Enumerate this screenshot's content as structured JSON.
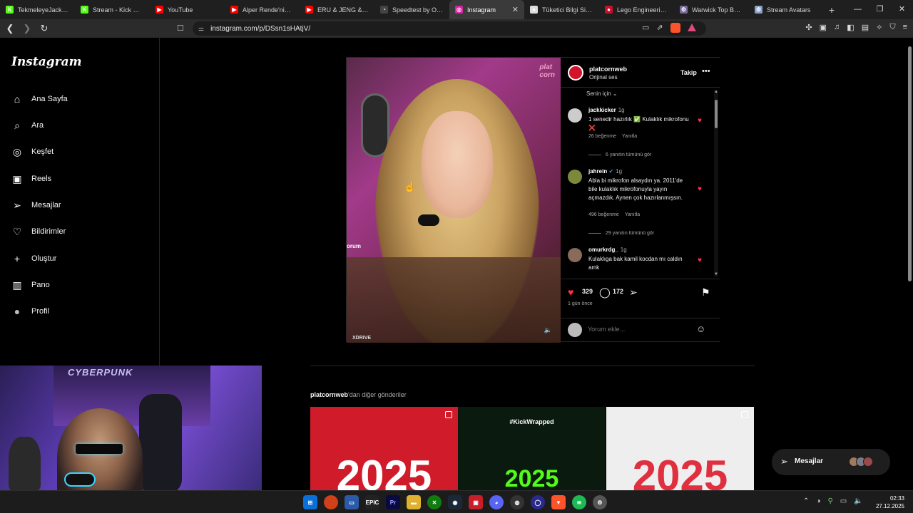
{
  "browser": {
    "tabs": [
      {
        "title": "TekmeleyeJack Strea",
        "fav_color": "#53fc18",
        "fav_text": "K"
      },
      {
        "title": "Stream - Kick Dashb",
        "fav_color": "#53fc18",
        "fav_text": "K"
      },
      {
        "title": "YouTube",
        "fav_color": "#ff0000",
        "fav_text": "▶"
      },
      {
        "title": "Alper Rende'nin Am",
        "fav_color": "#ff0000",
        "fav_text": "▶"
      },
      {
        "title": "ERU & JENG & KOK",
        "fav_color": "#ff0000",
        "fav_text": "▶"
      },
      {
        "title": "Speedtest by Ookla",
        "fav_color": "#444444",
        "fav_text": "◔"
      },
      {
        "title": "Instagram",
        "fav_color": "#d6249f",
        "fav_text": "◎",
        "active": true
      },
      {
        "title": "Tüketici Bilgi Sistem",
        "fav_color": "#dddddd",
        "fav_text": "●"
      },
      {
        "title": "Lego Engineering: B",
        "fav_color": "#c8102e",
        "fav_text": "●"
      },
      {
        "title": "Warwick Top Build U",
        "fav_color": "#7a6a9a",
        "fav_text": "⚙"
      },
      {
        "title": "Stream Avatars",
        "fav_color": "#8aa0c8",
        "fav_text": "⚙"
      }
    ],
    "url": "instagram.com/p/DSsn1sHAtjV/"
  },
  "sidebar": {
    "logo": "Instagram",
    "items": [
      {
        "label": "Ana Sayfa",
        "icon": "home-icon",
        "glyph": "⌂"
      },
      {
        "label": "Ara",
        "icon": "search-icon",
        "glyph": "⌕"
      },
      {
        "label": "Keşfet",
        "icon": "compass-icon",
        "glyph": "◎"
      },
      {
        "label": "Reels",
        "icon": "reels-icon",
        "glyph": "▣"
      },
      {
        "label": "Mesajlar",
        "icon": "send-icon",
        "glyph": "➢"
      },
      {
        "label": "Bildirimler",
        "icon": "heart-icon",
        "glyph": "♡"
      },
      {
        "label": "Oluştur",
        "icon": "plus-icon",
        "glyph": "+"
      },
      {
        "label": "Pano",
        "icon": "dashboard-icon",
        "glyph": "▥"
      },
      {
        "label": "Profil",
        "icon": "profile-avatar-icon",
        "glyph": "●"
      }
    ]
  },
  "post": {
    "username": "platcornweb",
    "audio": "Orijinal ses",
    "follow_label": "Takip",
    "media_overlay_text": "orum",
    "media_watermark": "XDRIVE",
    "sort_label": "Senin için",
    "comments": [
      {
        "user": "jackkicker",
        "age": "1g",
        "text": "1 senedir hazırlık ✅ Kulaklık mikrofonu ❌",
        "likes": "26 beğenme",
        "reply": "Yanıtla",
        "replies": "6 yanıtın tümünü gör",
        "verified": false,
        "avatar_color": "#cccccc"
      },
      {
        "user": "jahrein",
        "age": "1g",
        "text": "Abla bi mikrofon alsaydın ya. 2011'de bile kulaklık mikrofonuyla yayın açmazdık. Aynen çok hazırlanmışsın.",
        "likes": "496 beğenme",
        "reply": "Yanıtla",
        "replies": "29 yanıtın tümünü gör",
        "verified": true,
        "avatar_color": "#7a8a3a"
      },
      {
        "user": "omurkrdg_",
        "age": "1g",
        "text": "Kulaklıga bak kamil kocdan mı caldın amk",
        "likes": "",
        "reply": "",
        "replies": "",
        "verified": false,
        "avatar_color": "#8a6a5a"
      }
    ],
    "like_count": "329",
    "comment_count": "172",
    "date": "1 gün önce",
    "add_comment_placeholder": "Yorum ekle..."
  },
  "more_posts": {
    "user": "platcornweb",
    "suffix": "'dan diğer gönderiler",
    "thumbs": [
      {
        "label": "2025",
        "bg": "#d01c2a",
        "color": "#ffffff"
      },
      {
        "label": "#KickWrapped",
        "bg": "#0b1a0f",
        "color": "#ffffff"
      },
      {
        "label": "2025",
        "bg": "#eeeeee",
        "color": "#e03040"
      }
    ]
  },
  "messages_pill": {
    "label": "Mesajlar"
  },
  "webcam": {
    "poster_text": "CYBERPUNK"
  },
  "taskbar": {
    "time": "02:33",
    "date": "27.12.2025"
  }
}
